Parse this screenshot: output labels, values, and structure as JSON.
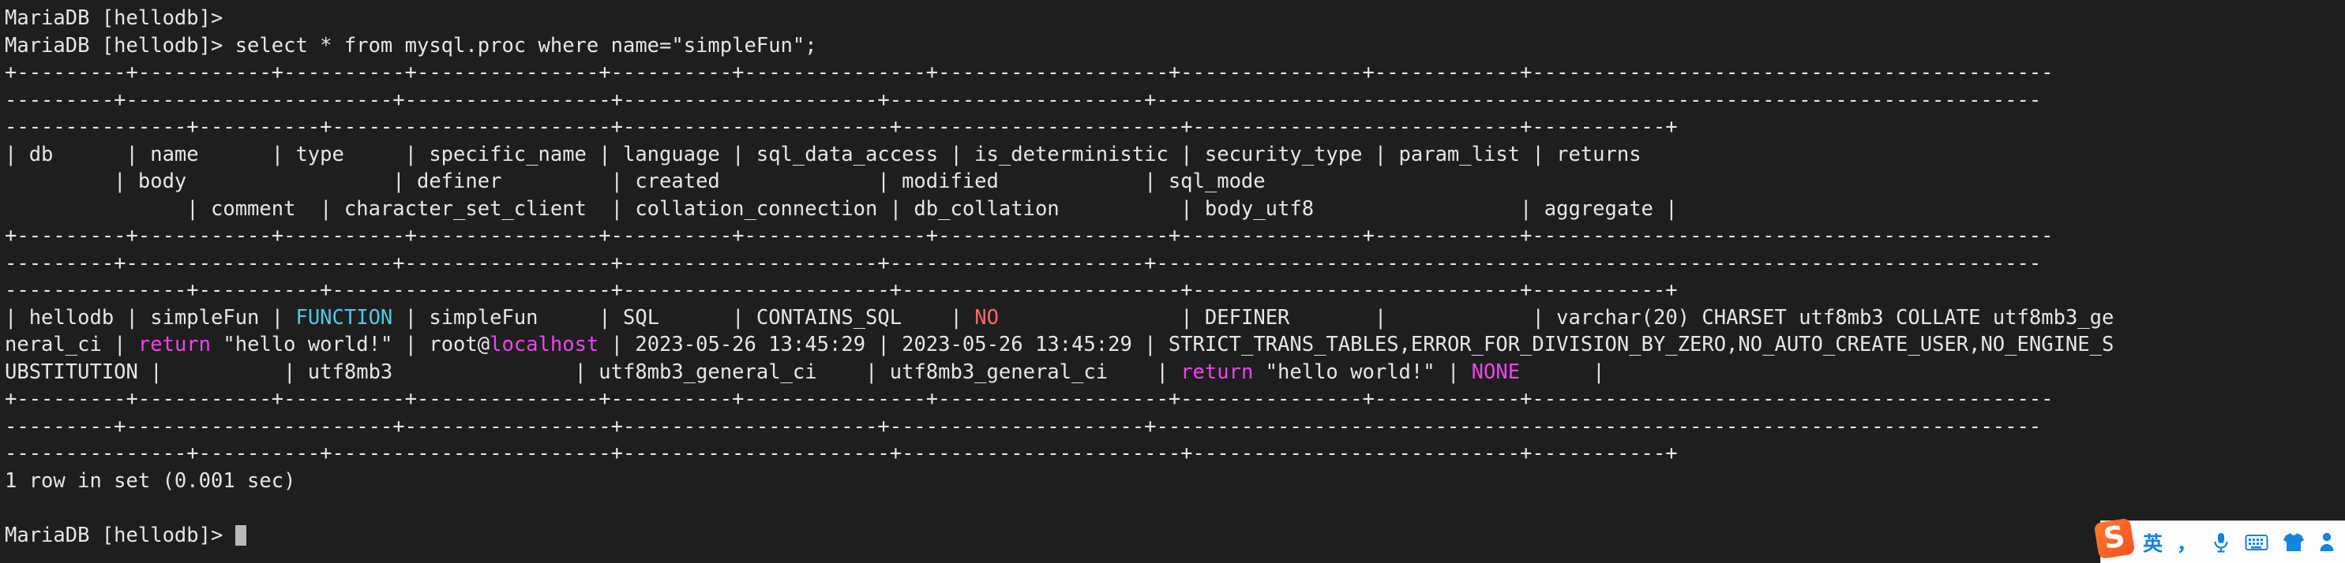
{
  "terminal": {
    "prompt": "MariaDB [hellodb]>",
    "colors": {
      "background": "#1e1e1e",
      "foreground": "#e6e6e6",
      "cyan": "#4fc8e8",
      "red": "#f06a6a",
      "magenta": "#ee44ee",
      "cursor": "#b9b9b9"
    },
    "lines": [
      {
        "id": "l0",
        "text": "MariaDB [hellodb]>"
      },
      {
        "id": "l1",
        "text": "MariaDB [hellodb]> select * from mysql.proc where name=\"simpleFun\";"
      },
      {
        "id": "l2",
        "text": "+---------+-----------+----------+---------------+----------+---------------+-------------------+---------------+------------+-------------------------------------------"
      },
      {
        "id": "l3",
        "text": "---------+----------------------+-----------------+---------------------+---------------------+-------------------------------------------------------------------------"
      },
      {
        "id": "l4",
        "text": "---------------+----------+-----------------------+----------------------+-----------------------+---------------------------+-----------+"
      },
      {
        "id": "l5",
        "text": "| db      | name      | type     | specific_name | language | sql_data_access | is_deterministic | security_type | param_list | returns"
      },
      {
        "id": "l6",
        "text": "         | body                 | definer         | created             | modified            | sql_mode"
      },
      {
        "id": "l7",
        "text": "               | comment  | character_set_client  | collation_connection | db_collation          | body_utf8                 | aggregate |"
      },
      {
        "id": "l8",
        "text": "+---------+-----------+----------+---------------+----------+---------------+-------------------+---------------+------------+-------------------------------------------"
      },
      {
        "id": "l9",
        "text": "---------+----------------------+-----------------+---------------------+---------------------+-------------------------------------------------------------------------"
      },
      {
        "id": "l10",
        "text": "---------------+----------+-----------------------+----------------------+-----------------------+---------------------------+-----------+"
      },
      {
        "id": "l14",
        "text": "+---------+-----------+----------+---------------+----------+---------------+-------------------+---------------+------------+-------------------------------------------"
      },
      {
        "id": "l15",
        "text": "---------+----------------------+-----------------+---------------------+---------------------+-------------------------------------------------------------------------"
      },
      {
        "id": "l16",
        "text": "---------------+----------+-----------------------+----------------------+-----------------------+---------------------------+-----------+"
      },
      {
        "id": "l17",
        "text": "1 row in set (0.001 sec)"
      }
    ],
    "result_row": {
      "line1": {
        "seg_a": "| hellodb | simpleFun | ",
        "type": "FUNCTION",
        "seg_b": " | simpleFun     | SQL      | CONTAINS_SQL    | ",
        "is_deterministic": "NO",
        "seg_c": "               | DEFINER       |            | varchar(20) CHARSET utf8mb3 COLLATE utf8mb3_ge"
      },
      "line2": {
        "seg_a": "neral_ci | ",
        "body_kw": "return",
        "seg_b": " \"hello world!\" | root@",
        "host": "localhost",
        "seg_c": " | 2023-05-26 13:45:29 | 2023-05-26 13:45:29 | STRICT_TRANS_TABLES,ERROR_FOR_DIVISION_BY_ZERO,NO_AUTO_CREATE_USER,NO_ENGINE_S"
      },
      "line3": {
        "seg_a": "UBSTITUTION |          | utf8mb3               | utf8mb3_general_ci    | utf8mb3_general_ci    | ",
        "body_kw": "return",
        "seg_b": " \"hello world!\" | ",
        "aggregate": "NONE",
        "seg_c": "      |"
      }
    },
    "final_prompt": "MariaDB [hellodb]> "
  },
  "ime": {
    "logo_letter": "S",
    "language_mode": "英",
    "punctuation": "，",
    "items": [
      {
        "name": "sogou-logo-icon",
        "label": "S"
      },
      {
        "name": "language-mode-button",
        "label": "英"
      },
      {
        "name": "punctuation-mode-button",
        "label": "，"
      },
      {
        "name": "voice-input-icon",
        "label": ""
      },
      {
        "name": "soft-keyboard-icon",
        "label": ""
      },
      {
        "name": "skin-icon",
        "label": ""
      },
      {
        "name": "toolbox-icon",
        "label": ""
      }
    ]
  }
}
